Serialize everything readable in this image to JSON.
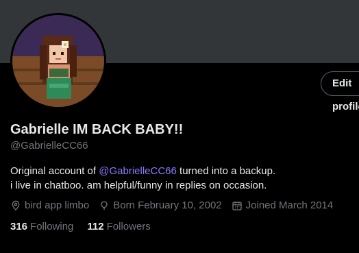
{
  "profile": {
    "display_name": "Gabrielle IM BACK BABY!!",
    "handle": "@GabrielleCC66",
    "bio_line1_prefix": "Original account of ",
    "bio_mention": "@GabrielleCC66",
    "bio_line1_suffix": " turned into a backup.",
    "bio_line2": "i live in chatboo. am helpful/funny in replies on occasion.",
    "location": "bird app limbo",
    "birthday": "Born February 10, 2002",
    "joined": "Joined March 2014",
    "following_count": "316",
    "following_label": "Following",
    "followers_count": "112",
    "followers_label": "Followers"
  },
  "actions": {
    "edit_label": "Edit profile"
  },
  "colors": {
    "banner": "#333639",
    "mention": "#8b7bff",
    "muted": "#71767b"
  },
  "icons": {
    "location": "location-pin-icon",
    "birthday": "balloon-icon",
    "joined": "calendar-icon"
  }
}
